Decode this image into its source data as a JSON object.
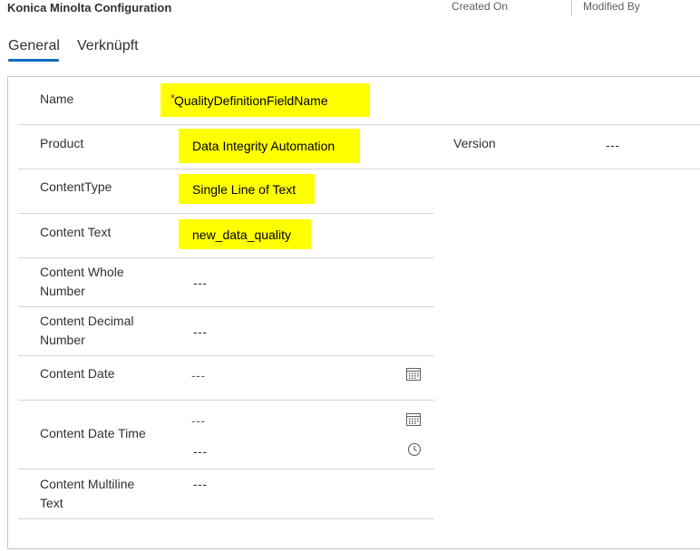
{
  "header": {
    "title": "Konica Minolta Configuration",
    "created_on_label": "Created On",
    "modified_by_label": "Modified By"
  },
  "tabs": [
    {
      "label": "General",
      "selected": true
    },
    {
      "label": "Verknüpft",
      "selected": false
    }
  ],
  "form": {
    "name": {
      "label": "Name",
      "value": "QualityDefinitionFieldName",
      "required_marker": "*"
    },
    "product": {
      "label": "Product",
      "value": "Data Integrity Automation"
    },
    "version": {
      "label": "Version",
      "value": "---"
    },
    "content_type": {
      "label": "ContentType",
      "value": "Single Line of Text"
    },
    "content_text": {
      "label": "Content Text",
      "value": "new_data_quality"
    },
    "content_whole_number": {
      "label_line1": "Content Whole",
      "label_line2": "Number",
      "value": "---"
    },
    "content_decimal_number": {
      "label_line1": "Content Decimal",
      "label_line2": "Number",
      "value": "---"
    },
    "content_date": {
      "label": "Content Date",
      "value": "---"
    },
    "content_date_time": {
      "label": "Content Date Time",
      "date_value": "---",
      "time_value": "---"
    },
    "content_multiline_text": {
      "label_line1": "Content Multiline",
      "label_line2": "Text",
      "value": "---"
    }
  },
  "colors": {
    "highlight": "#ffff00",
    "tab_accent": "#0f6cbd",
    "required": "#a4262c"
  },
  "icons": [
    "calendar-icon",
    "clock-icon"
  ]
}
